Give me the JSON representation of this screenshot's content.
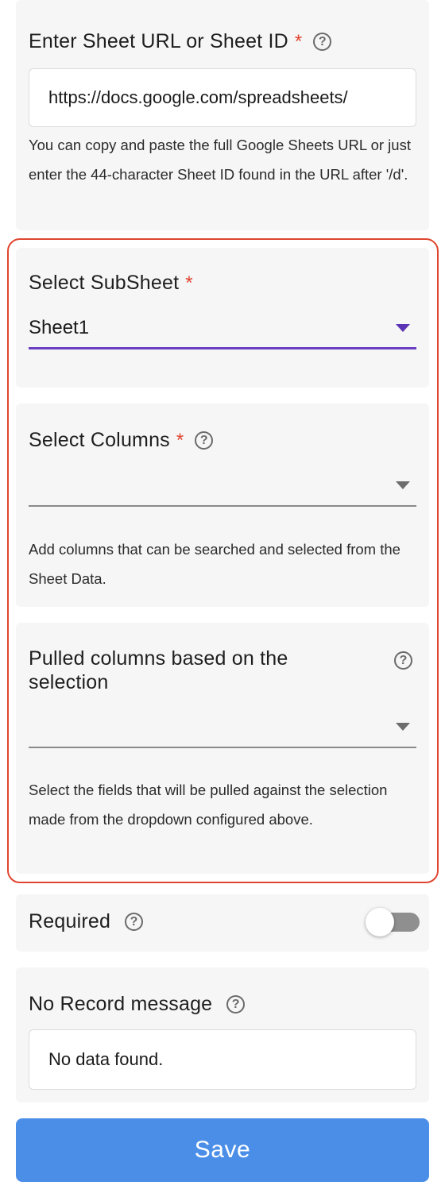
{
  "sheet_url": {
    "label": "Enter Sheet URL or Sheet ID",
    "required_mark": "*",
    "help_glyph": "?",
    "value": "https://docs.google.com/spreadsheets/",
    "hint": "You can copy and paste the full Google Sheets URL or just enter the 44-character Sheet ID found in the URL after '/d'."
  },
  "subsheet": {
    "label": "Select SubSheet",
    "required_mark": "*",
    "selected": "Sheet1"
  },
  "columns": {
    "label": "Select Columns",
    "required_mark": "*",
    "help_glyph": "?",
    "selected": "",
    "hint": "Add columns that can be searched and selected from the Sheet Data."
  },
  "pulled_columns": {
    "label_line1": "Pulled columns based on the",
    "label_line2": "selection",
    "help_glyph": "?",
    "selected": "",
    "hint": "Select the fields that will be pulled against the selection made from the dropdown configured above."
  },
  "required_toggle": {
    "label": "Required",
    "help_glyph": "?",
    "on": false
  },
  "no_record": {
    "label": "No Record message",
    "help_glyph": "?",
    "value": "No data found."
  },
  "save_button": {
    "label": "Save"
  },
  "colors": {
    "accent_purple": "#6a3fc2",
    "required_red": "#e0432f",
    "save_blue": "#4a8ee8",
    "highlight_border": "#e0462f"
  },
  "icons": [
    "help-circle-icon",
    "chevron-down-icon"
  ]
}
